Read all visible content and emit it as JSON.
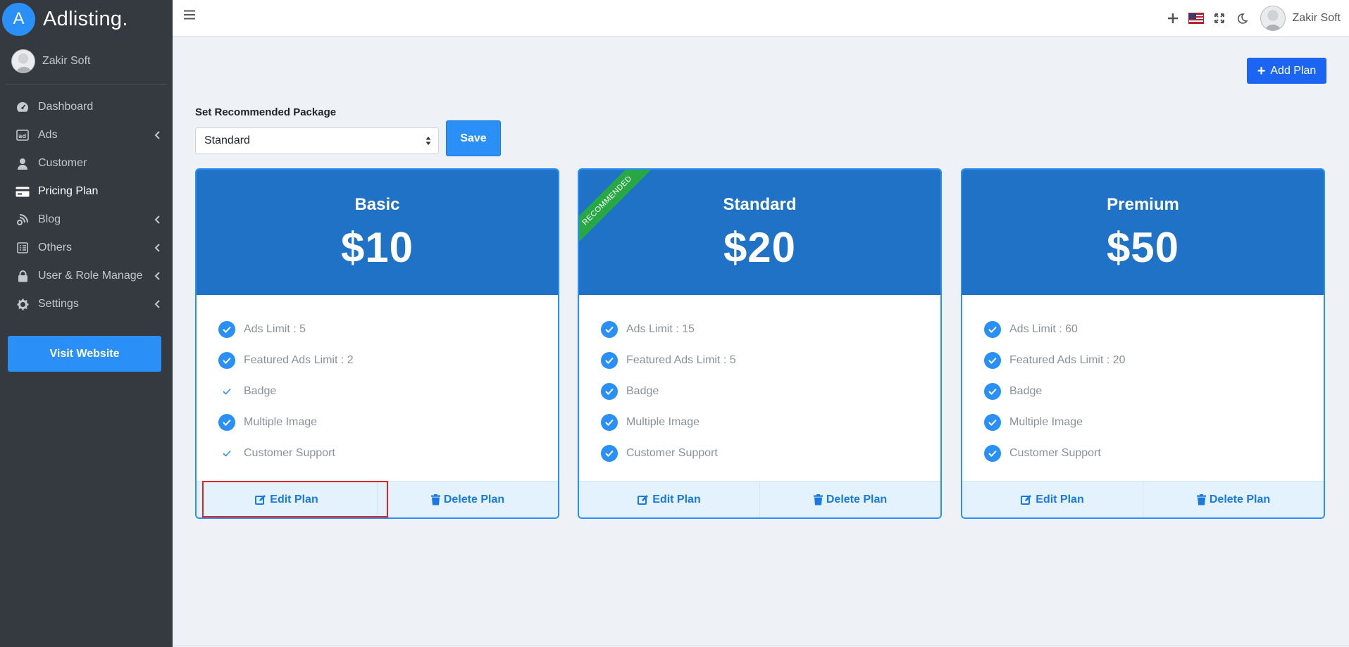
{
  "brand": {
    "logo_letter": "A",
    "name": "Adlisting."
  },
  "sidebar": {
    "user_name": "Zakir Soft",
    "items": [
      {
        "label": "Dashboard",
        "icon": "dashboard-icon",
        "has_arrow": false
      },
      {
        "label": "Ads",
        "icon": "ad-icon",
        "has_arrow": true
      },
      {
        "label": "Customer",
        "icon": "user-icon",
        "has_arrow": false
      },
      {
        "label": "Pricing Plan",
        "icon": "credit-card-icon",
        "has_arrow": false,
        "active": true
      },
      {
        "label": "Blog",
        "icon": "blog-icon",
        "has_arrow": true
      },
      {
        "label": "Others",
        "icon": "list-icon",
        "has_arrow": true
      },
      {
        "label": "User & Role Manage",
        "icon": "lock-icon",
        "has_arrow": true
      },
      {
        "label": "Settings",
        "icon": "gear-icon",
        "has_arrow": true
      }
    ],
    "visit_button": "Visit Website"
  },
  "topbar": {
    "icons": [
      "hamburger-icon",
      "plus-icon",
      "us-flag-icon",
      "fullscreen-icon",
      "moon-icon"
    ],
    "user_name": "Zakir Soft"
  },
  "content": {
    "add_plan_label": "Add Plan",
    "recommended_label": "Set Recommended Package",
    "recommended_value": "Standard",
    "save_label": "Save",
    "ribbon_text": "RECOMMENDED",
    "edit_label": "Edit Plan",
    "delete_label": "Delete Plan"
  },
  "plans": [
    {
      "name": "Basic",
      "price": "$10",
      "recommended": false,
      "features": [
        {
          "text": "Ads Limit : 5",
          "style": "filled"
        },
        {
          "text": "Featured Ads Limit : 2",
          "style": "filled"
        },
        {
          "text": "Badge",
          "style": "plain"
        },
        {
          "text": "Multiple Image",
          "style": "filled"
        },
        {
          "text": "Customer Support",
          "style": "plain"
        }
      ]
    },
    {
      "name": "Standard",
      "price": "$20",
      "recommended": true,
      "features": [
        {
          "text": "Ads Limit : 15",
          "style": "filled"
        },
        {
          "text": "Featured Ads Limit : 5",
          "style": "filled"
        },
        {
          "text": "Badge",
          "style": "filled"
        },
        {
          "text": "Multiple Image",
          "style": "filled"
        },
        {
          "text": "Customer Support",
          "style": "filled"
        }
      ]
    },
    {
      "name": "Premium",
      "price": "$50",
      "recommended": false,
      "features": [
        {
          "text": "Ads Limit : 60",
          "style": "filled"
        },
        {
          "text": "Featured Ads Limit : 20",
          "style": "filled"
        },
        {
          "text": "Badge",
          "style": "filled"
        },
        {
          "text": "Multiple Image",
          "style": "filled"
        },
        {
          "text": "Customer Support",
          "style": "filled"
        }
      ]
    }
  ],
  "colors": {
    "sidebar_bg": "#343a40",
    "accent": "#2a8ff7",
    "card_header": "#1f72c6",
    "add_button": "#1c64f2",
    "ribbon": "#28a745",
    "highlight": "#dc2626"
  }
}
